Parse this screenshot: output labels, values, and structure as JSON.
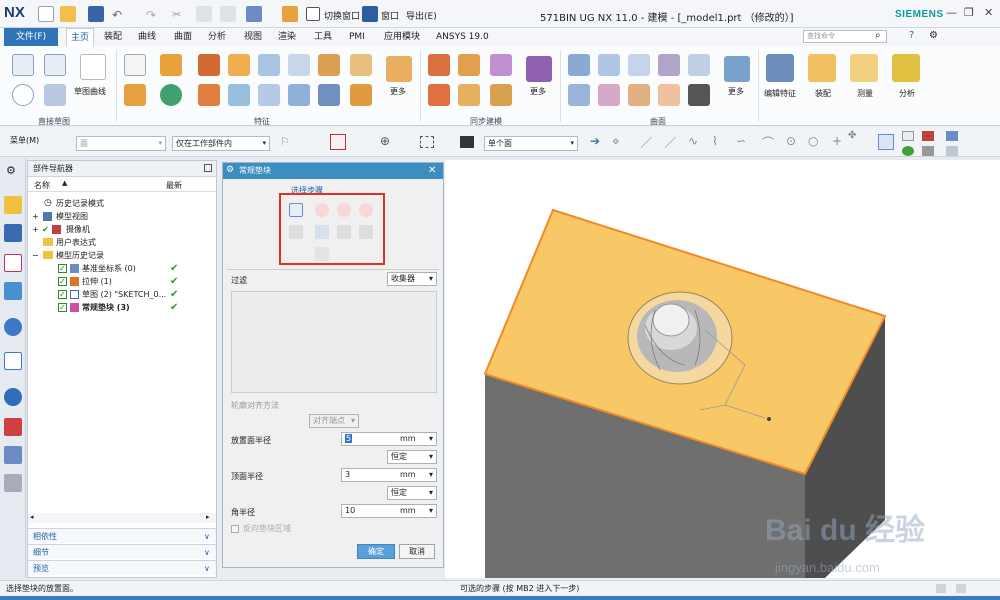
{
  "window": {
    "app_logo": "NX",
    "title": "571BIN UG NX 11.0 - 建模 - [_model1.prt （修改的）]",
    "brand": "SIEMENS",
    "switch_window_label": "切换窗口",
    "window_menu_label": "窗口",
    "export_label": "导出(E)"
  },
  "menu": {
    "file_label": "文件(F)",
    "tabs": [
      "主页",
      "装配",
      "曲线",
      "曲面",
      "分析",
      "视图",
      "渲染",
      "工具",
      "PMI",
      "应用模块",
      "ANSYS 19.0"
    ],
    "active_tab": "主页",
    "search_placeholder": "查找命令"
  },
  "ribbon": {
    "groups": [
      {
        "label": "直接草图"
      },
      {
        "label": "特征"
      },
      {
        "label": "同步建模"
      },
      {
        "label": "曲面"
      }
    ],
    "sketch_curve_label": "草图曲线",
    "more_label": "更多",
    "right_groups": [
      "编辑特征",
      "装配",
      "测量",
      "分析"
    ]
  },
  "toolbar": {
    "menu_label": "菜单(M)",
    "filter_value": "面",
    "scope_value": "仅在工作部件内",
    "face_rule_value": "单个面"
  },
  "navigator": {
    "title": "部件导航器",
    "col_name": "名称",
    "col_latest": "最新",
    "rows": [
      {
        "label": "历史记录模式",
        "indent": 0,
        "check": false,
        "latest": ""
      },
      {
        "label": "模型视图",
        "indent": 0,
        "check": false,
        "latest": ""
      },
      {
        "label": "摄像机",
        "indent": 0,
        "check": true,
        "latest": ""
      },
      {
        "label": "用户表达式",
        "indent": 0,
        "check": false,
        "latest": ""
      },
      {
        "label": "模型历史记录",
        "indent": 0,
        "check": false,
        "latest": ""
      },
      {
        "label": "基准坐标系 (0)",
        "indent": 1,
        "check": true,
        "latest": "✔"
      },
      {
        "label": "拉伸 (1)",
        "indent": 1,
        "check": true,
        "latest": "✔"
      },
      {
        "label": "草图 (2) \"SKETCH_0...",
        "indent": 1,
        "check": true,
        "latest": "✔"
      },
      {
        "label": "常规垫块 (3)",
        "indent": 1,
        "check": true,
        "latest": "✔"
      }
    ],
    "panels": [
      "相依性",
      "细节",
      "预览"
    ]
  },
  "dialog": {
    "title": "常规垫块",
    "select_step_label": "选择步骤",
    "filter_label": "过滤",
    "filter_value": "收集器",
    "contour_align_label": "轮廓对齐方法",
    "align_value": "对齐端点",
    "place_radius_label": "放置面半径",
    "place_radius_value": "5",
    "place_radius_unit": "mm",
    "place_radius_mode": "恒定",
    "top_radius_label": "顶面半径",
    "top_radius_value": "3",
    "top_radius_unit": "mm",
    "top_radius_mode": "恒定",
    "corner_radius_label": "角半径",
    "corner_radius_value": "10",
    "corner_radius_unit": "mm",
    "reverse_label": "反向垫块区域",
    "ok_label": "确定",
    "cancel_label": "取消"
  },
  "status": {
    "left": "选择垫块的放置面。",
    "center": "可选的步骤 (按 MB2 进入下一步)"
  },
  "watermark": {
    "text": "Bai du 经验",
    "url": "jingyan.baidu.com"
  },
  "colors": {
    "accent": "#3073b6",
    "dialog_title": "#3c8ec0",
    "highlight_red": "#e0302a",
    "model_top": "#f8c866",
    "model_edge": "#f08a28"
  }
}
